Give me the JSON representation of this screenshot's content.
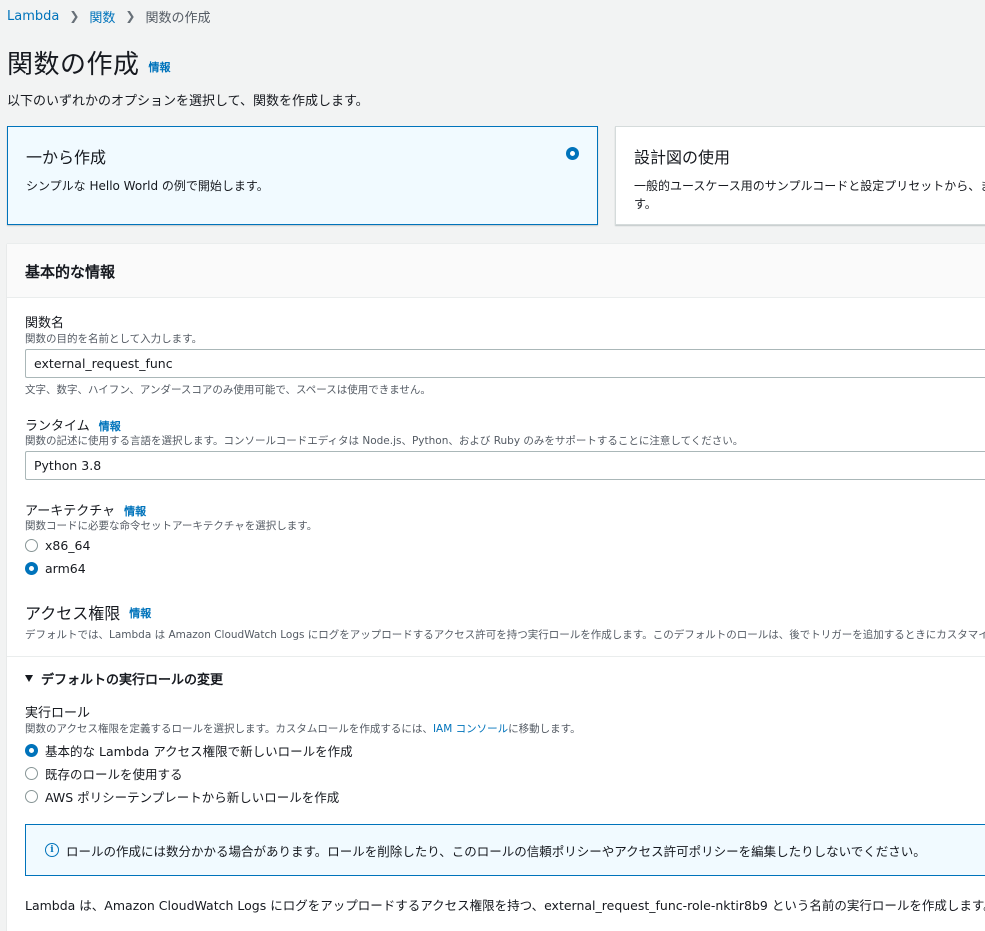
{
  "breadcrumb": {
    "items": [
      "Lambda",
      "関数",
      "関数の作成"
    ]
  },
  "header": {
    "title": "関数の作成",
    "info": "情報",
    "subtitle": "以下のいずれかのオプションを選択して、関数を作成します。"
  },
  "options": [
    {
      "title": "一から作成",
      "description": "シンプルな Hello World の例で開始します。",
      "selected": true
    },
    {
      "title": "設計図の使用",
      "description": "一般的ユースケース用のサンプルコードと設定プリセットから、ます。",
      "selected": false
    }
  ],
  "basic_info": {
    "title": "基本的な情報",
    "function_name": {
      "label": "関数名",
      "description": "関数の目的を名前として入力します。",
      "value": "external_request_func",
      "constraint": "文字、数字、ハイフン、アンダースコアのみ使用可能で、スペースは使用できません。"
    },
    "runtime": {
      "label": "ランタイム",
      "info": "情報",
      "description": "関数の記述に使用する言語を選択します。コンソールコードエディタは Node.js、Python、および Ruby のみをサポートすることに注意してください。",
      "value": "Python 3.8"
    },
    "architecture": {
      "label": "アーキテクチャ",
      "info": "情報",
      "description": "関数コードに必要な命令セットアーキテクチャを選択します。",
      "options": [
        "x86_64",
        "arm64"
      ],
      "selected": "arm64"
    },
    "permissions": {
      "title": "アクセス権限",
      "info": "情報",
      "description": "デフォルトでは、Lambda は Amazon CloudWatch Logs にログをアップロードするアクセス許可を持つ実行ロールを作成します。このデフォルトのロールは、後でトリガーを追加するときにカスタマイ"
    },
    "role_section": {
      "expander_label": "デフォルトの実行ロールの変更",
      "label": "実行ロール",
      "description_prefix": "関数のアクセス権限を定義するロールを選択します。カスタムロールを作成するには、",
      "description_link": "IAM コンソール",
      "description_suffix": "に移動します。",
      "options": [
        "基本的な Lambda アクセス権限で新しいロールを作成",
        "既存のロールを使用する",
        "AWS ポリシーテンプレートから新しいロールを作成"
      ],
      "selected_index": 0,
      "alert": "ロールの作成には数分かかる場合があります。ロールを削除したり、このロールの信頼ポリシーやアクセス許可ポリシーを編集したりしないでください。",
      "note": "Lambda は、Amazon CloudWatch Logs にログをアップロードするアクセス権限を持つ、external_request_func-role-nktir8b9 という名前の実行ロールを作成します。"
    }
  },
  "colors": {
    "accent": "#0073bb",
    "background": "#f2f3f3",
    "selected_card": "#f1faff"
  }
}
